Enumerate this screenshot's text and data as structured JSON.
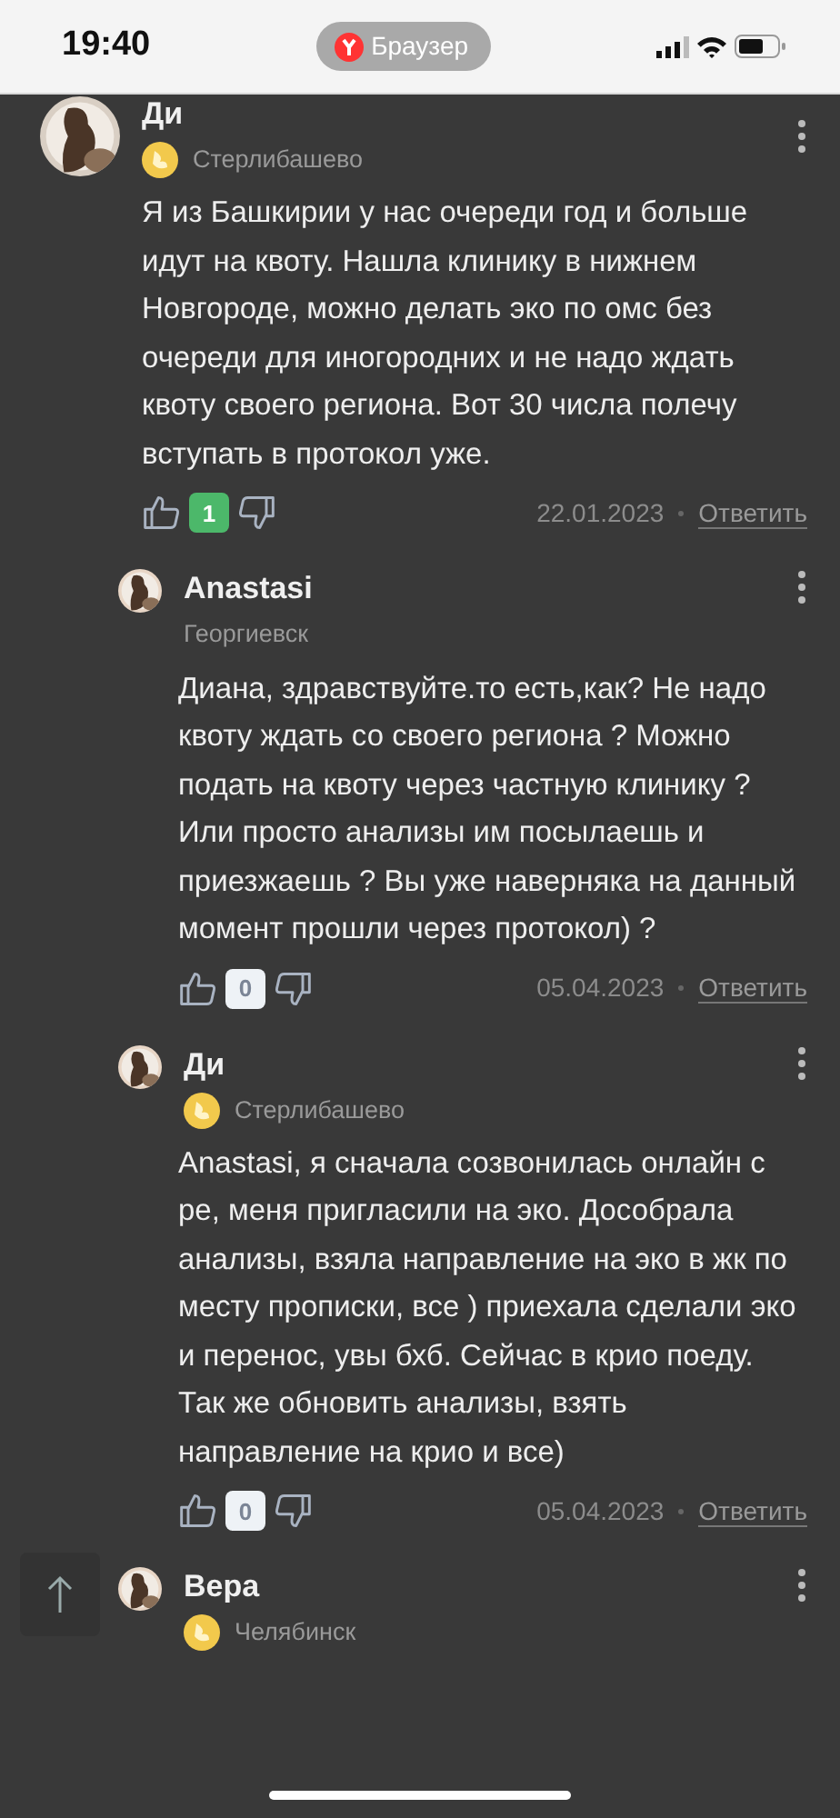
{
  "status_bar": {
    "time": "19:40",
    "app_pill": "Браузер"
  },
  "comments": [
    {
      "author": "Ди",
      "has_badge": true,
      "location": "Стерлибашево",
      "text": "Я из Башкирии у нас очереди год и больше идут на квоту. Нашла клинику в нижнем Новгороде, можно делать эко по омс без очереди для иногородних и не надо ждать квоту своего региона. Вот 30 числа полечу вступать в протокол уже.",
      "votes": "1",
      "positive": true,
      "date": "22.01.2023",
      "reply": "Ответить",
      "children": [
        {
          "author": "Anastasi",
          "has_badge": false,
          "location": "Георгиевск",
          "text": "Диана, здравствуйте.то есть,как? Не надо квоту ждать со своего региона ? Можно подать на квоту через частную клинику ? Или просто анализы им посылаешь и приезжаешь ? Вы уже наверняка на данный момент прошли через протокол) ?",
          "votes": "0",
          "positive": false,
          "date": "05.04.2023",
          "reply": "Ответить"
        },
        {
          "author": "Ди",
          "has_badge": true,
          "location": "Стерлибашево",
          "text": "Anastasi, я сначала созвонилась онлайн с ре, меня пригласили на эко. Дособрала анализы, взяла направление на эко в жк по месту прописки, все ) приехала сделали эко и перенос, увы бхб. Сейчас в крио поеду. Так же обновить анализы, взять направление на крио и все)",
          "votes": "0",
          "positive": false,
          "date": "05.04.2023",
          "reply": "Ответить"
        },
        {
          "author": "Вера",
          "has_badge": true,
          "location": "Челябинск"
        }
      ]
    }
  ]
}
